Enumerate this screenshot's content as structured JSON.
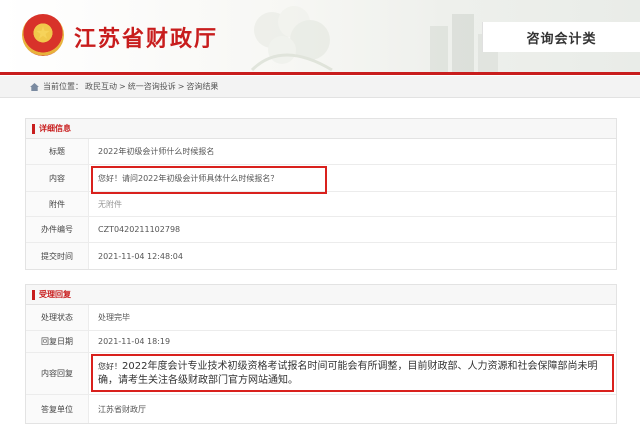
{
  "header": {
    "site_title": "江苏省财政厅",
    "category": "咨询会计类"
  },
  "breadcrumb": {
    "prefix": "当前位置：",
    "items": [
      "政民互动",
      "统一咨询投诉",
      "咨询结果"
    ],
    "separator": ">"
  },
  "detail": {
    "title": "详细信息",
    "rows": [
      {
        "label": "标题",
        "value": "2022年初级会计师什么时候报名"
      },
      {
        "label": "内容",
        "value": "您好！请问2022年初级会计师具体什么时候报名？"
      },
      {
        "label": "附件",
        "value": "无附件"
      },
      {
        "label": "办件编号",
        "value": "CZT0420211102798"
      },
      {
        "label": "提交时间",
        "value": "2021-11-04 12:48:04"
      }
    ]
  },
  "reply": {
    "title": "受理回复",
    "rows": [
      {
        "label": "处理状态",
        "value": "处理完毕"
      },
      {
        "label": "回复日期",
        "value": "2021-11-04 18:19"
      },
      {
        "label": "内容回复",
        "value_prefix": "您好！",
        "value": "2022年度会计专业技术初级资格考试报名时间可能会有所调整，目前财政部、人力资源和社会保障部尚未明确，请考生关注各级财政部门官方网站通知。"
      },
      {
        "label": "答复单位",
        "value": "江苏省财政厅"
      }
    ]
  },
  "colors": {
    "brand_red": "#c81d1d",
    "highlight_red": "#d9211d"
  }
}
